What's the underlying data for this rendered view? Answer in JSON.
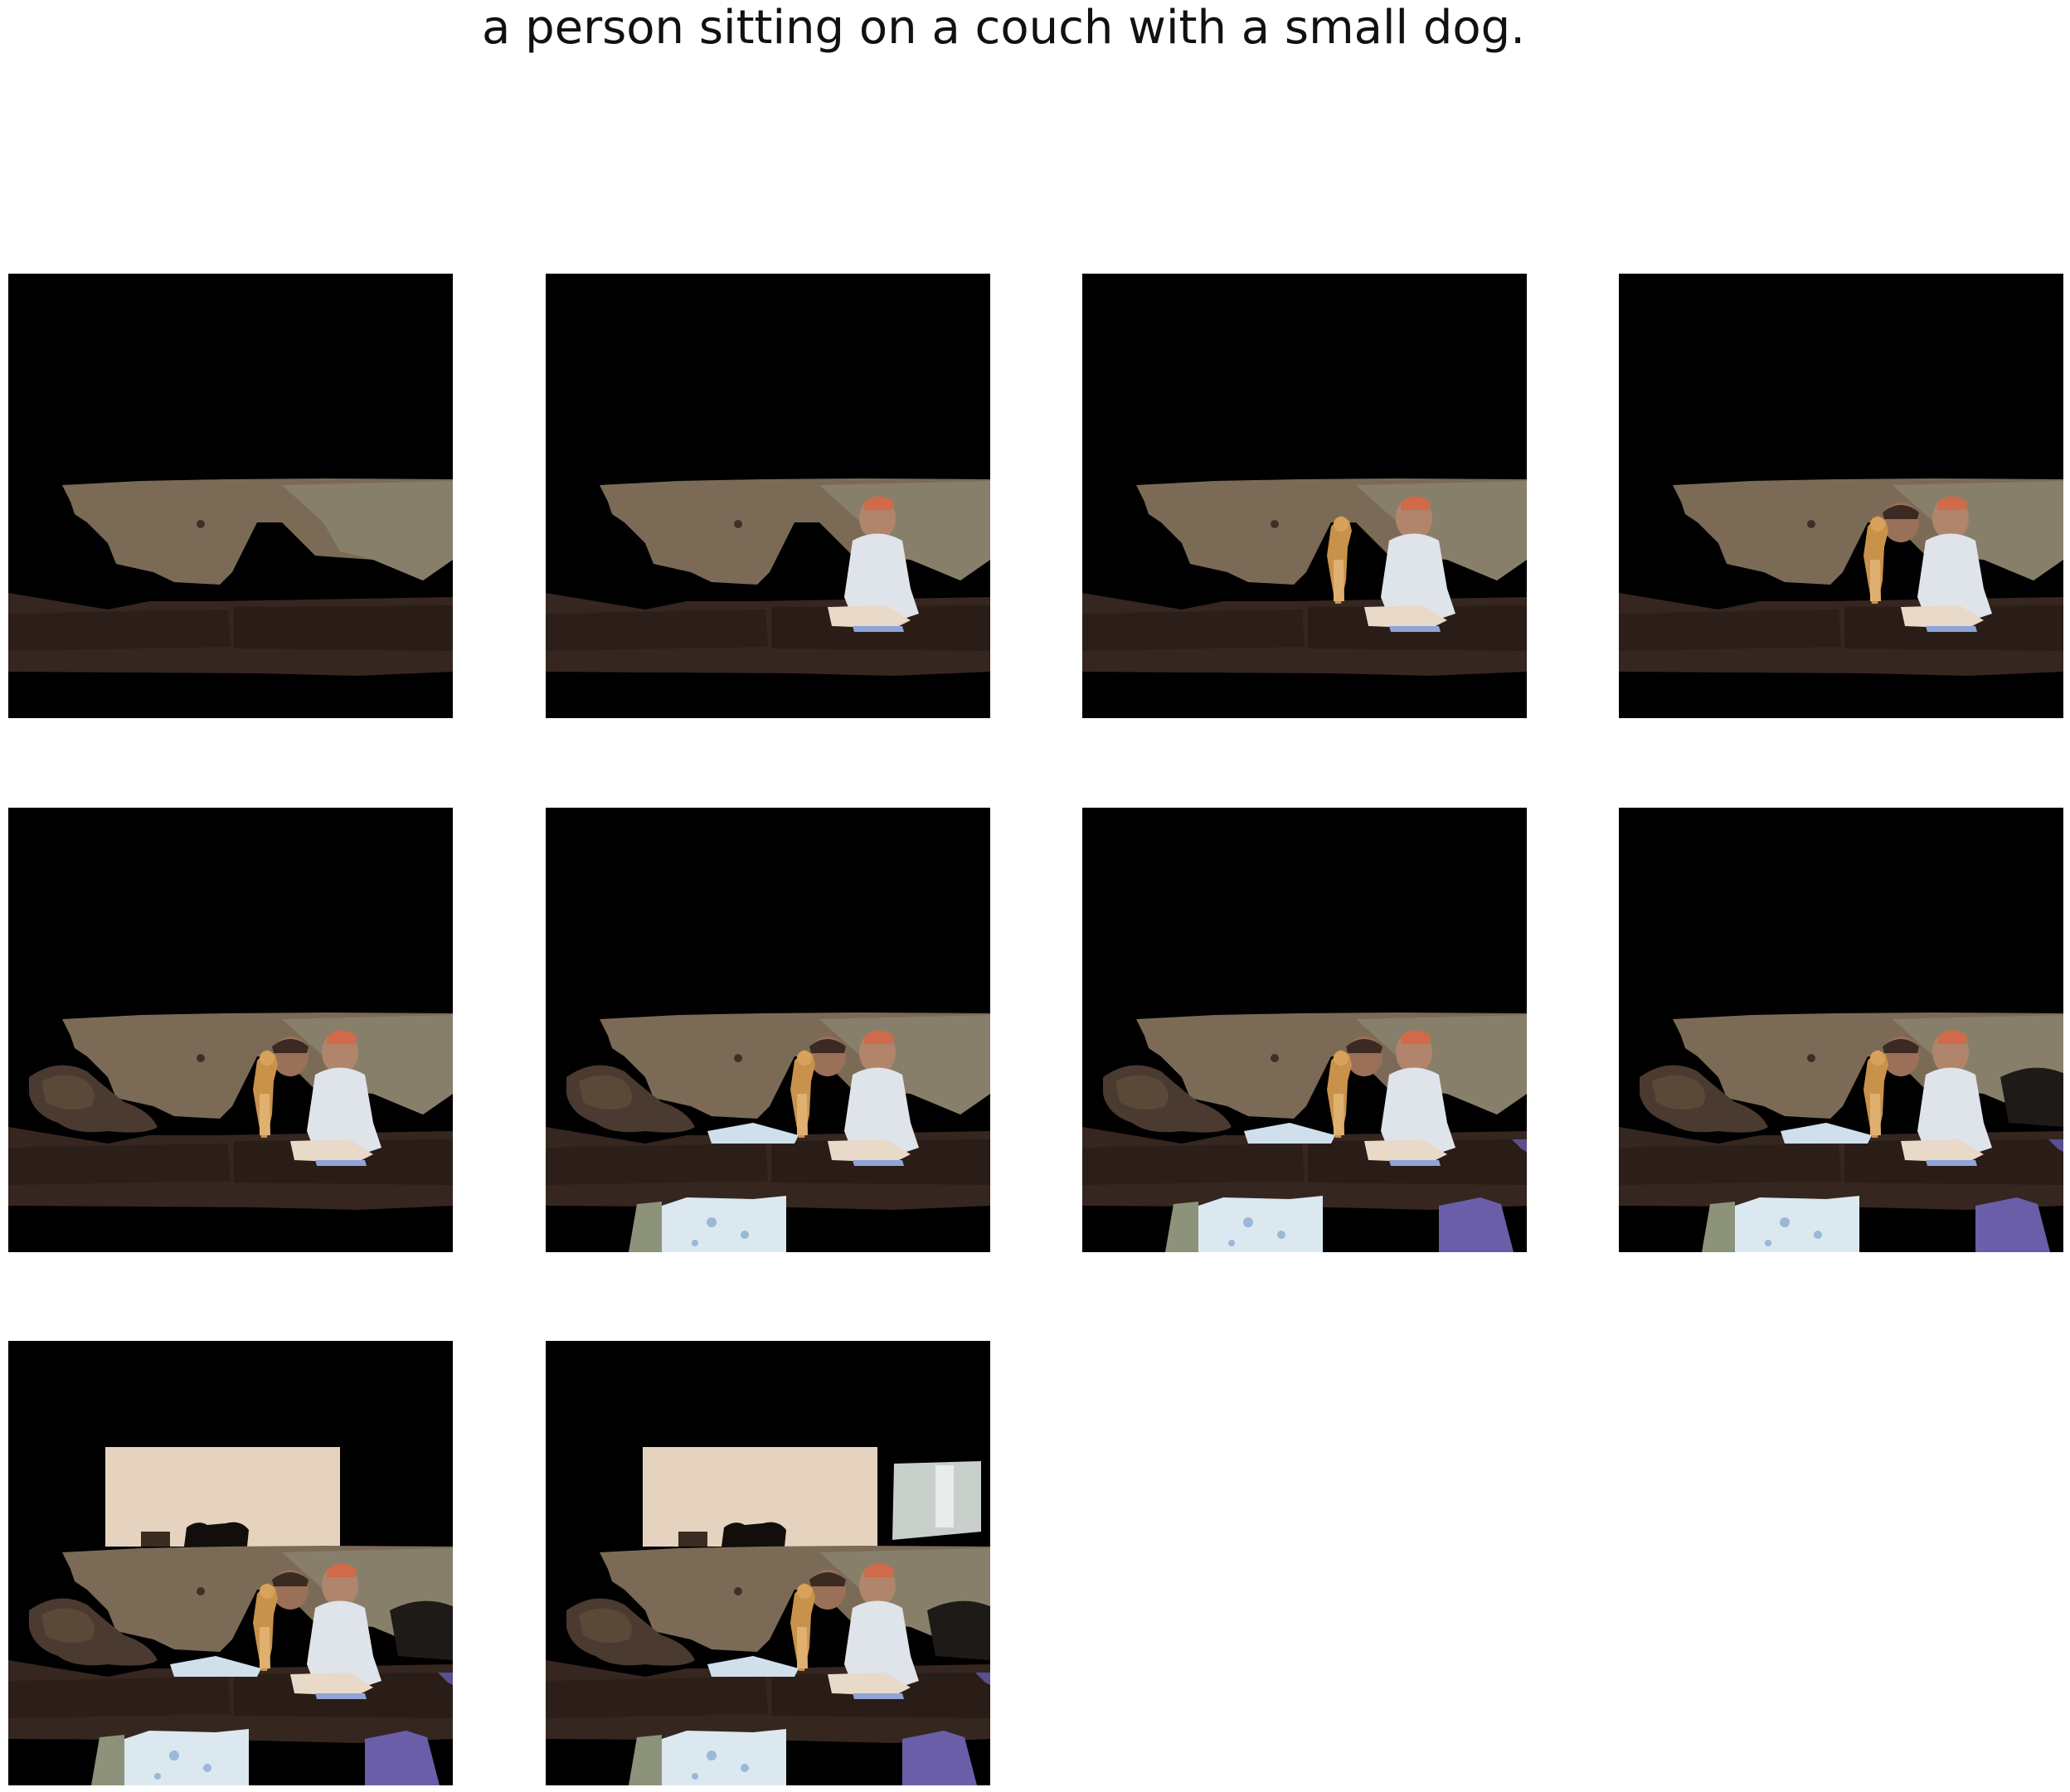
{
  "caption": "a person sitting on a couch with a small dog.",
  "panels": [
    {
      "step": 1,
      "segments": [
        "wall",
        "couch"
      ]
    },
    {
      "step": 2,
      "segments": [
        "wall",
        "couch",
        "person"
      ]
    },
    {
      "step": 3,
      "segments": [
        "wall",
        "couch",
        "person",
        "dog"
      ]
    },
    {
      "step": 4,
      "segments": [
        "wall",
        "couch",
        "person",
        "dog",
        "second-person"
      ]
    },
    {
      "step": 5,
      "segments": [
        "wall",
        "couch",
        "person",
        "dog",
        "second-person",
        "cushion-left"
      ]
    },
    {
      "step": 6,
      "segments": [
        "wall",
        "couch",
        "person",
        "dog",
        "second-person",
        "cushion-left",
        "blanket"
      ]
    },
    {
      "step": 7,
      "segments": [
        "wall",
        "couch",
        "person",
        "dog",
        "second-person",
        "cushion-left",
        "blanket",
        "purple-pillow"
      ]
    },
    {
      "step": 8,
      "segments": [
        "wall",
        "couch",
        "person",
        "dog",
        "second-person",
        "cushion-left",
        "blanket",
        "purple-pillow",
        "dark-cushion-right"
      ]
    },
    {
      "step": 9,
      "segments": [
        "wall",
        "couch",
        "person",
        "dog",
        "second-person",
        "cushion-left",
        "blanket",
        "purple-pillow",
        "dark-cushion-right",
        "upper-wall"
      ]
    },
    {
      "step": 10,
      "segments": [
        "wall",
        "couch",
        "person",
        "dog",
        "second-person",
        "cushion-left",
        "blanket",
        "purple-pillow",
        "dark-cushion-right",
        "upper-wall",
        "window"
      ]
    }
  ],
  "colors": {
    "background": "#000000",
    "wall": "#7a6a55",
    "couch": "#3a2a22",
    "upper_wall": "#e6d2be",
    "purple": "#6a5ea8"
  }
}
